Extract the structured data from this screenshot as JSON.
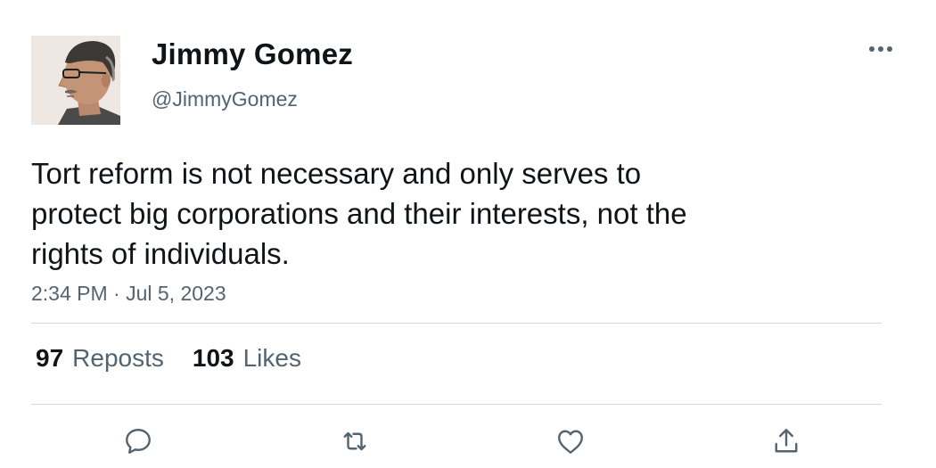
{
  "author": {
    "display_name": "Jimmy Gomez",
    "handle": "@JimmyGomez",
    "avatar_icon": "profile-photo"
  },
  "tweet": {
    "text_lines": [
      "Tort reform is not necessary and only serves to",
      "protect big corporations and their interests, not the",
      "rights of individuals."
    ],
    "timestamp": "2:34 PM · Jul 5, 2023"
  },
  "stats": {
    "reposts_count": "97",
    "reposts_label": "Reposts",
    "likes_count": "103",
    "likes_label": "Likes"
  },
  "actions": {
    "icons": [
      "reply-icon",
      "repost-icon",
      "like-icon",
      "share-icon"
    ]
  },
  "colors": {
    "text_primary": "#0f1419",
    "text_secondary": "#536471",
    "divider": "#cfd9de"
  }
}
